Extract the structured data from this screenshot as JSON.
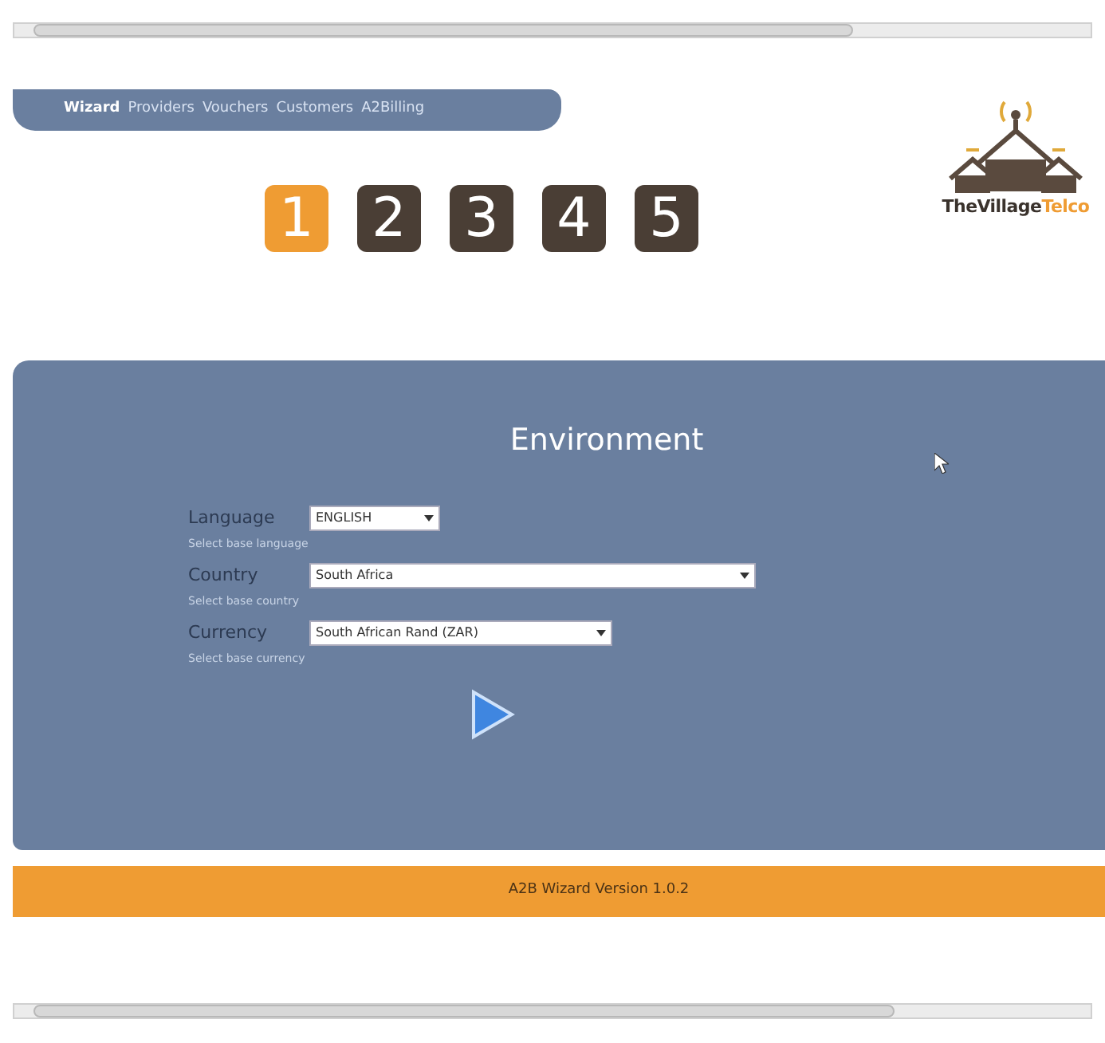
{
  "nav": [
    {
      "label": "Wizard",
      "selected": true
    },
    {
      "label": "Providers",
      "selected": false
    },
    {
      "label": "Vouchers",
      "selected": false
    },
    {
      "label": "Customers",
      "selected": false
    },
    {
      "label": "A2Billing",
      "selected": false
    }
  ],
  "steps": [
    {
      "label": "1",
      "selected": true
    },
    {
      "label": "2",
      "selected": false
    },
    {
      "label": "3",
      "selected": false
    },
    {
      "label": "4",
      "selected": false
    },
    {
      "label": "5",
      "selected": false
    }
  ],
  "logo": {
    "name_part_1": "TheVillage",
    "name_part_2": "Telco"
  },
  "panel": {
    "title": "Environment",
    "fields": [
      {
        "label": "Language",
        "value": "ENGLISH",
        "hint": "Select base language",
        "kind": "short"
      },
      {
        "label": "Country",
        "value": "South Africa",
        "hint": "Select base country",
        "kind": "long"
      },
      {
        "label": "Currency",
        "value": "South African Rand (ZAR)",
        "hint": "Select base currency",
        "kind": "medium"
      }
    ]
  },
  "footer": "A2B Wizard Version 1.0.2"
}
